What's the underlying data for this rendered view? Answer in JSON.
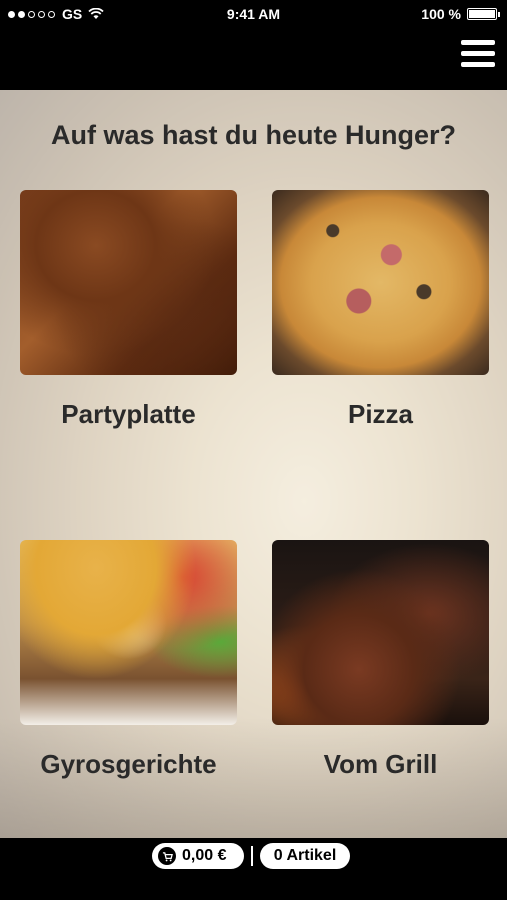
{
  "status_bar": {
    "carrier": "GS",
    "time": "9:41 AM",
    "battery": "100 %"
  },
  "nav": {
    "menu_icon": "hamburger-menu-icon"
  },
  "main": {
    "heading": "Auf was hast du heute Hunger?",
    "categories": [
      {
        "label": "Partyplatte",
        "image": "roasted meat platter"
      },
      {
        "label": "Pizza",
        "image": "pizza"
      },
      {
        "label": "Gyrosgerichte",
        "image": "gyros with fries and salad"
      },
      {
        "label": "Vom Grill",
        "image": "grilled steaks"
      }
    ]
  },
  "cart": {
    "icon": "cart-icon",
    "total": "0,00 €",
    "separator": "|",
    "items": "0 Artikel"
  }
}
